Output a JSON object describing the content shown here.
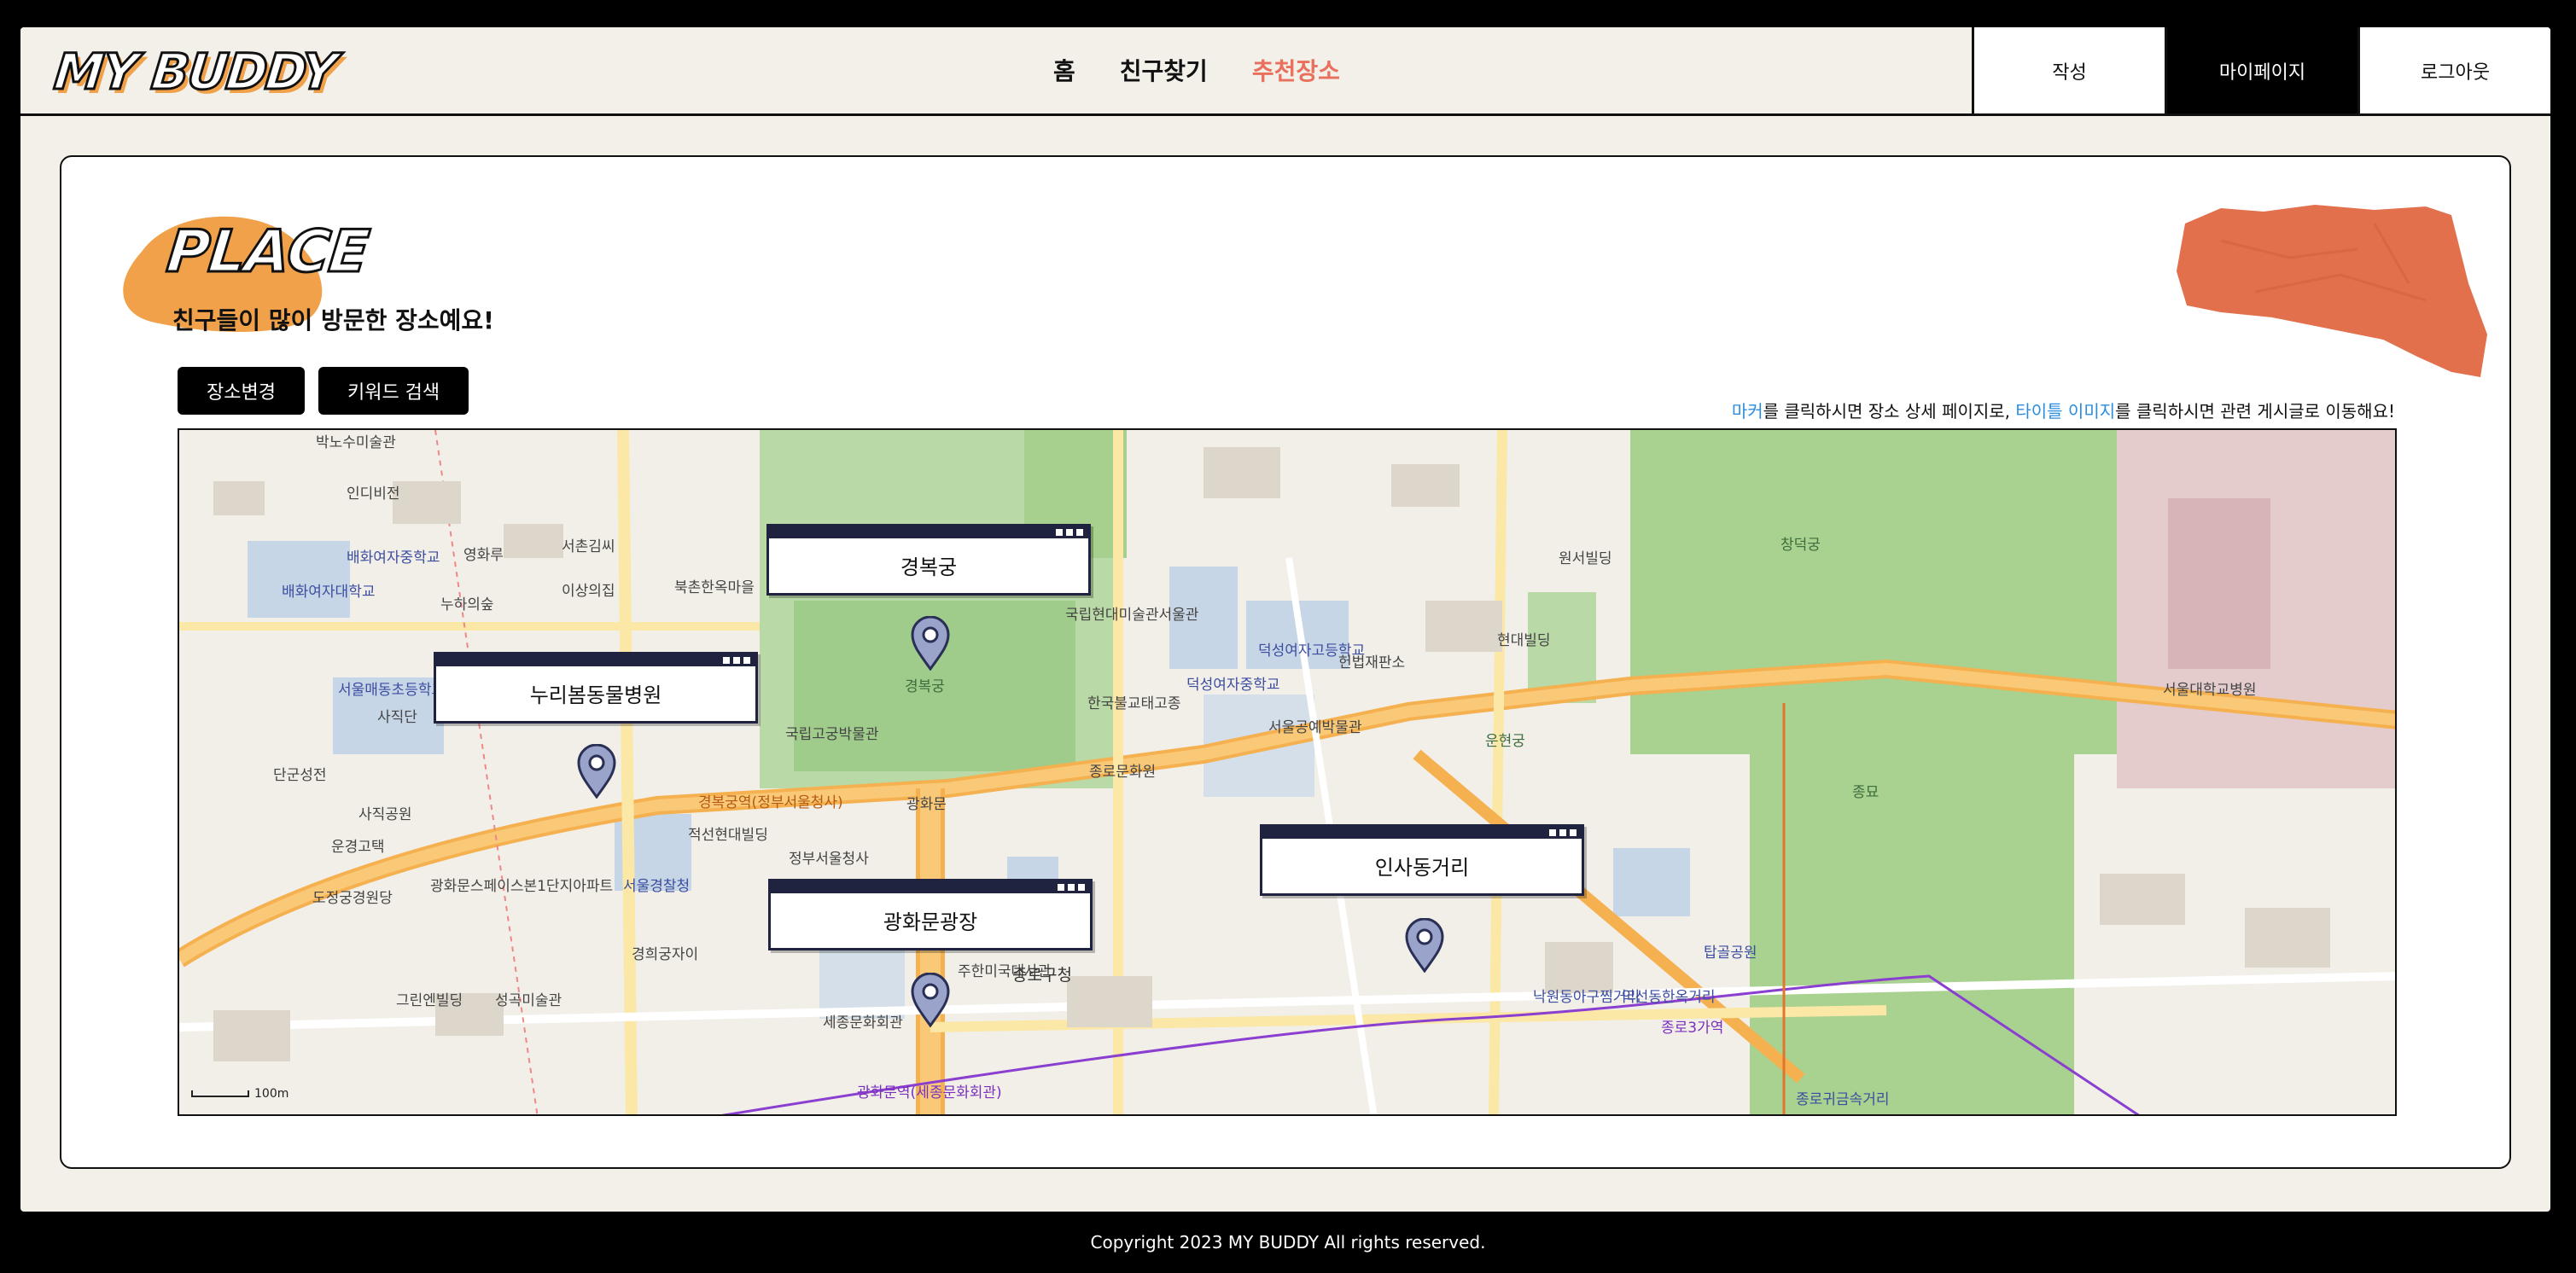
{
  "header": {
    "logo": "MY BUDDY",
    "nav": [
      {
        "label": "홈",
        "active": false
      },
      {
        "label": "친구찾기",
        "active": false
      },
      {
        "label": "추천장소",
        "active": true
      }
    ],
    "buttons": [
      {
        "label": "작성"
      },
      {
        "label": "마이페이지"
      },
      {
        "label": "로그아웃"
      }
    ],
    "active_color": "#e8705d"
  },
  "page": {
    "title": "PLACE",
    "subtitle": "친구들이 많이 방문한 장소예요!",
    "buttons": {
      "change_place": "장소변경",
      "keyword_search": "키워드 검색"
    },
    "hint": {
      "part1": "마커",
      "part2": "를 클릭하시면 장소 상세 페이지로, ",
      "part3": "타이틀 이미지",
      "part4": "를 클릭하시면 관련 게시글로 이동해요!"
    },
    "accent_color": "#f0a14a",
    "deco_color": "#e2704d"
  },
  "map": {
    "places": [
      {
        "name": "경복궁"
      },
      {
        "name": "누리봄동물병원"
      },
      {
        "name": "광화문광장"
      },
      {
        "name": "인사동거리"
      }
    ],
    "labels": {
      "l1": "박노수미술관",
      "l2": "인디비전",
      "l3": "영화루",
      "l4": "배화여자중학교",
      "l5": "배화여자대학교",
      "l6": "서촌김씨",
      "l7": "이상의집",
      "l8": "누하의숲",
      "l9": "서울매동초등학교",
      "l10": "사직단",
      "l11": "단군성전",
      "l12": "사직공원",
      "l13": "운경고택",
      "l14": "도정궁경원당",
      "l15": "광화문스페이스본1단지아파트",
      "l16": "그린엔빌딩",
      "l17": "성곡미술관",
      "l18": "경희궁자이",
      "l19": "서울경찰청",
      "l20": "적선현대빌딩",
      "l21": "정부서울청사",
      "l22": "세종문화회관",
      "l23": "주한미국대사관",
      "l24": "종로구청",
      "l25": "광화문",
      "l26": "국립고궁박물관",
      "l27": "경복궁",
      "l28": "국립현대미술관서울관",
      "l29": "한국불교태고종",
      "l30": "종로문화원",
      "l31": "덕성여자중학교",
      "l32": "덕성여자고등학교",
      "l33": "서울공예박물관",
      "l34": "헌법재판소",
      "l35": "운현궁",
      "l36": "창덕궁",
      "l37": "종묘",
      "l38": "서울대학교병원",
      "l39": "낙원동아구찜거리",
      "l40": "익선동한옥거리",
      "l41": "탑골공원",
      "l42": "종로3가역",
      "l43": "광화문역(세종문화회관)",
      "l44": "경복궁역(정부서울청사)",
      "l45": "종로귀금속거리",
      "l46": "원서빌딩",
      "l47": "현대빌딩",
      "l48": "북촌한옥마을"
    },
    "scale": "100m"
  },
  "footer": {
    "copyright": "Copyright 2023 MY BUDDY All rights reserved."
  }
}
